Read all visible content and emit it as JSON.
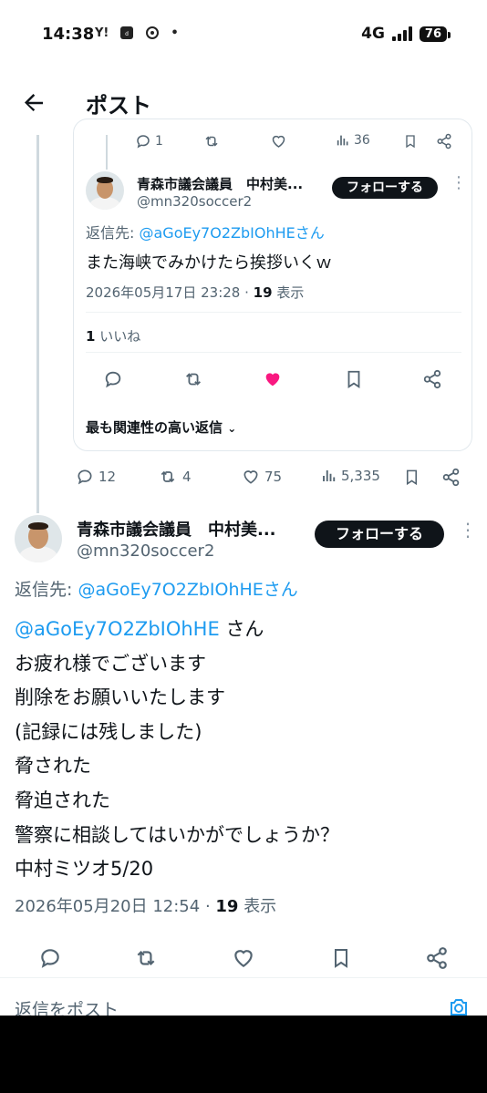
{
  "status_bar": {
    "time": "14:38",
    "left_icons": [
      "Y!",
      "dcard",
      "threads",
      "•"
    ],
    "network": "4G",
    "battery": "76"
  },
  "header": {
    "title": "ポスト"
  },
  "quoted_top_actions": {
    "reply_count": "1",
    "retweet_count": "",
    "views": "36"
  },
  "inner_reply": {
    "name": "青森市議会議員　中村美...",
    "handle": "@mn320soccer2",
    "follow_label": "フォローする",
    "reply_prefix": "返信先: ",
    "reply_target": "@aGoEy7O2ZbIOhHEさん",
    "text": "また海峡でみかけたら挨拶いくｗ",
    "timestamp": "2026年05月17日 23:28",
    "view_count": "19",
    "view_label": "表示",
    "likes_count": "1",
    "likes_label": "いいね",
    "sort_label": "最も関連性の高い返信",
    "like_active_color": "#f91880"
  },
  "outer_actions": {
    "replies": "12",
    "retweets": "4",
    "likes": "75",
    "views": "5,335"
  },
  "main_post": {
    "name": "青森市議会議員　中村美...",
    "handle": "@mn320soccer2",
    "follow_label": "フォローする",
    "reply_prefix": "返信先: ",
    "reply_target": "@aGoEy7O2ZbIOhHEさん",
    "mention": "@aGoEy7O2ZbIOhHE",
    "lines": [
      "さん",
      "お疲れ様でございます",
      "削除をお願いいたします",
      "(記録には残しました)",
      "脅された",
      "脅迫された",
      "警察に相談してはいかがでしょうか？",
      "中村ミツオ5/20"
    ],
    "timestamp": "2026年05月20日 12:54",
    "view_count": "19",
    "view_label": "表示"
  },
  "reply_bar": {
    "placeholder": "返信をポスト"
  },
  "colors": {
    "link": "#1d9bf0",
    "muted": "#536471",
    "text": "#0f1419",
    "like_pink": "#f91880"
  }
}
